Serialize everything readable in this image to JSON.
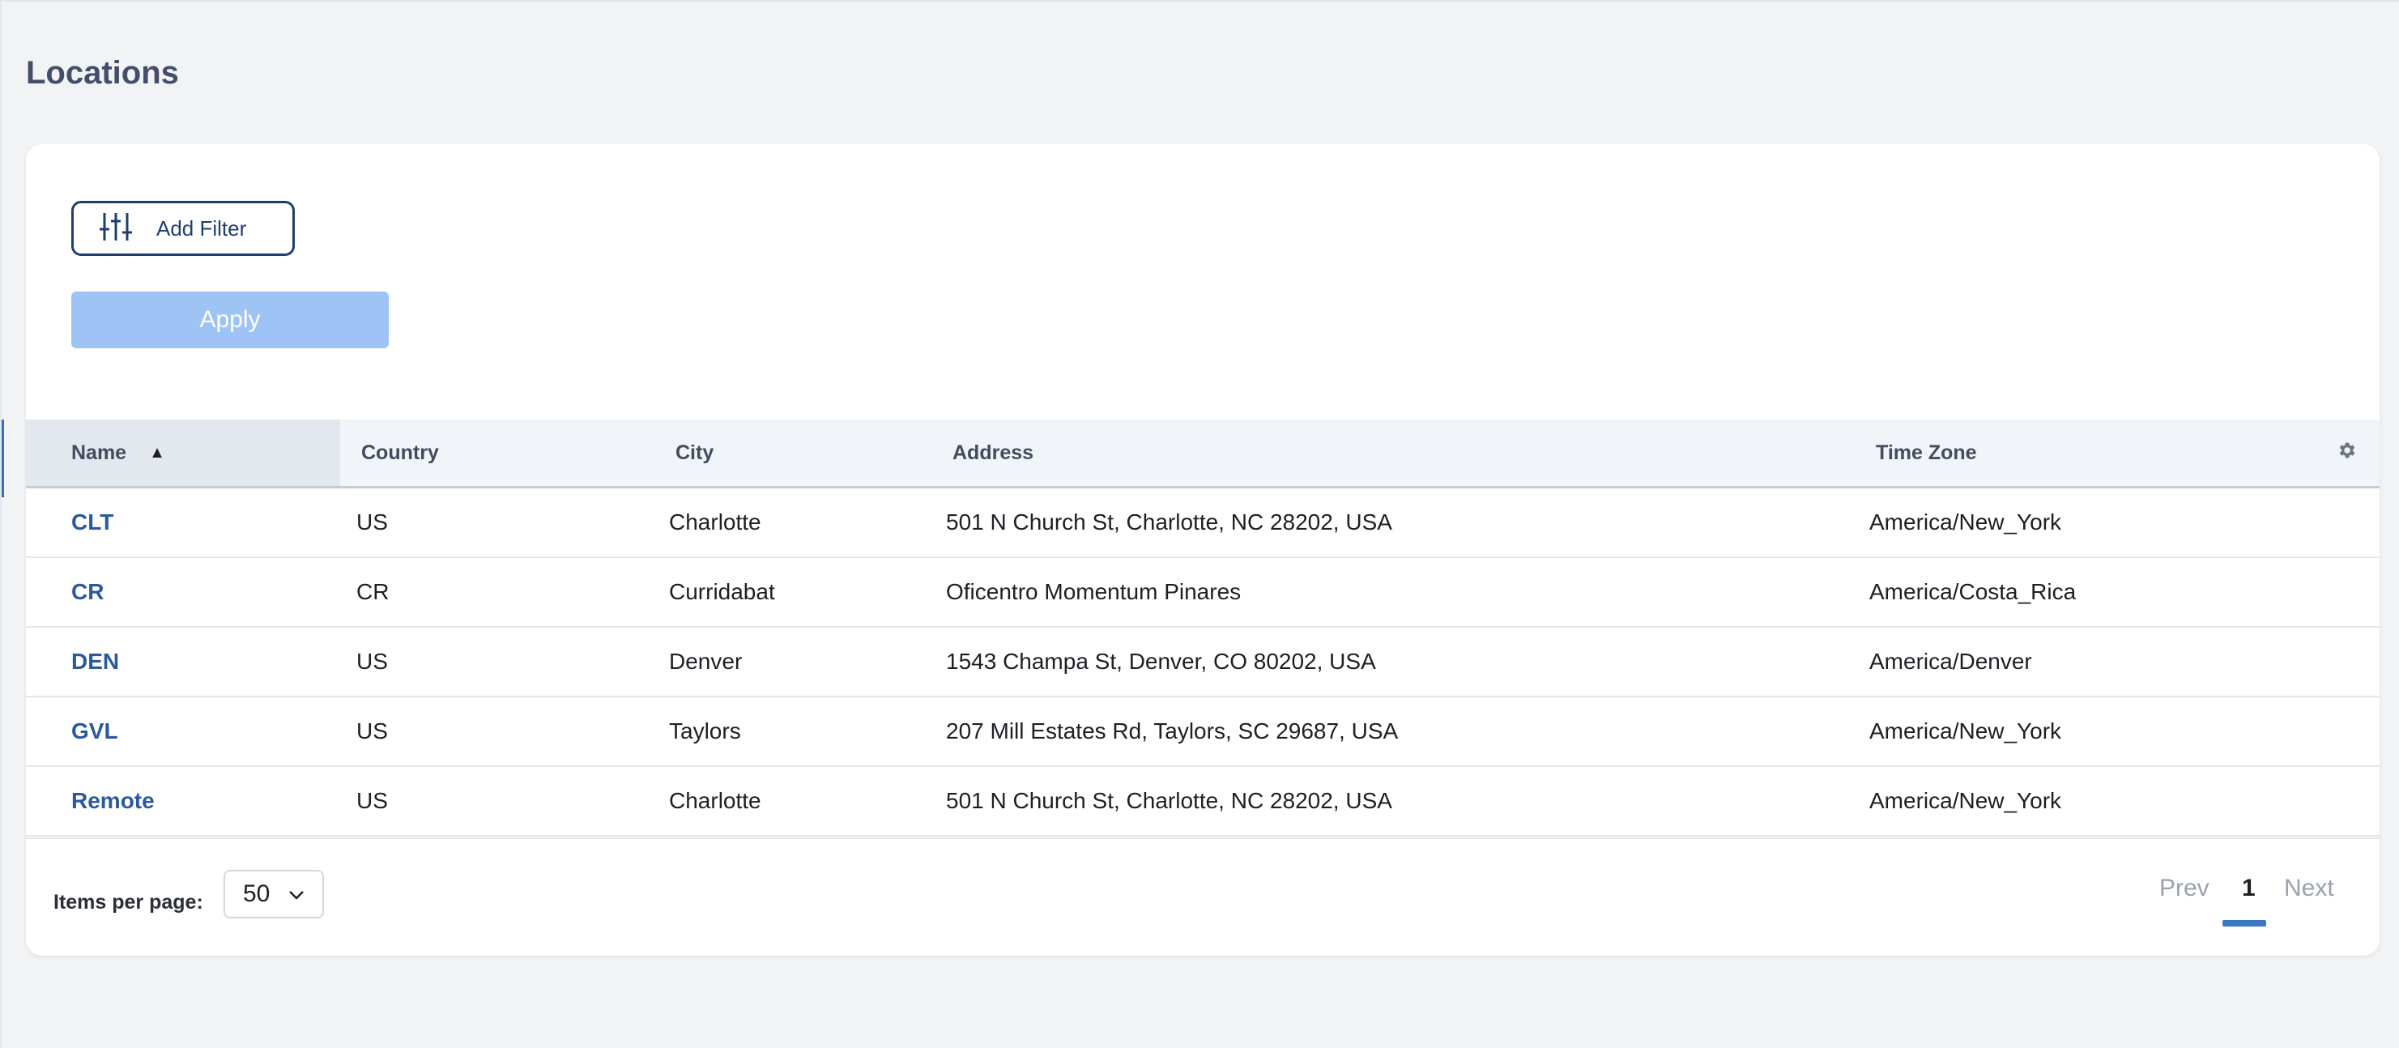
{
  "page": {
    "title": "Locations"
  },
  "filters": {
    "add_filter_label": "Add Filter",
    "apply_label": "Apply"
  },
  "table": {
    "columns": [
      {
        "label": "Name",
        "sorted": "ascending"
      },
      {
        "label": "Country"
      },
      {
        "label": "City"
      },
      {
        "label": "Address"
      },
      {
        "label": "Time Zone"
      }
    ],
    "rows": [
      {
        "name": "CLT",
        "country": "US",
        "city": "Charlotte",
        "address": "501 N Church St, Charlotte, NC 28202, USA",
        "time_zone": "America/New_York"
      },
      {
        "name": "CR",
        "country": "CR",
        "city": "Curridabat",
        "address": "Oficentro Momentum Pinares",
        "time_zone": "America/Costa_Rica"
      },
      {
        "name": "DEN",
        "country": "US",
        "city": "Denver",
        "address": "1543 Champa St, Denver, CO 80202, USA",
        "time_zone": "America/Denver"
      },
      {
        "name": "GVL",
        "country": "US",
        "city": "Taylors",
        "address": "207 Mill Estates Rd, Taylors, SC 29687, USA",
        "time_zone": "America/New_York"
      },
      {
        "name": "Remote",
        "country": "US",
        "city": "Charlotte",
        "address": "501 N Church St, Charlotte, NC 28202, USA",
        "time_zone": "America/New_York"
      }
    ],
    "settings_icon": "gear-icon",
    "sort_icon": "sort-ascending-icon"
  },
  "pagination": {
    "items_per_page_label": "Items per page:",
    "items_per_page_value": "50",
    "prev_label": "Prev",
    "current_page": "1",
    "next_label": "Next"
  },
  "colors": {
    "link": "#2a5a9c",
    "apply_disabled": "#9dc4f5",
    "accent": "#3a78c6",
    "title": "#434e6b"
  }
}
